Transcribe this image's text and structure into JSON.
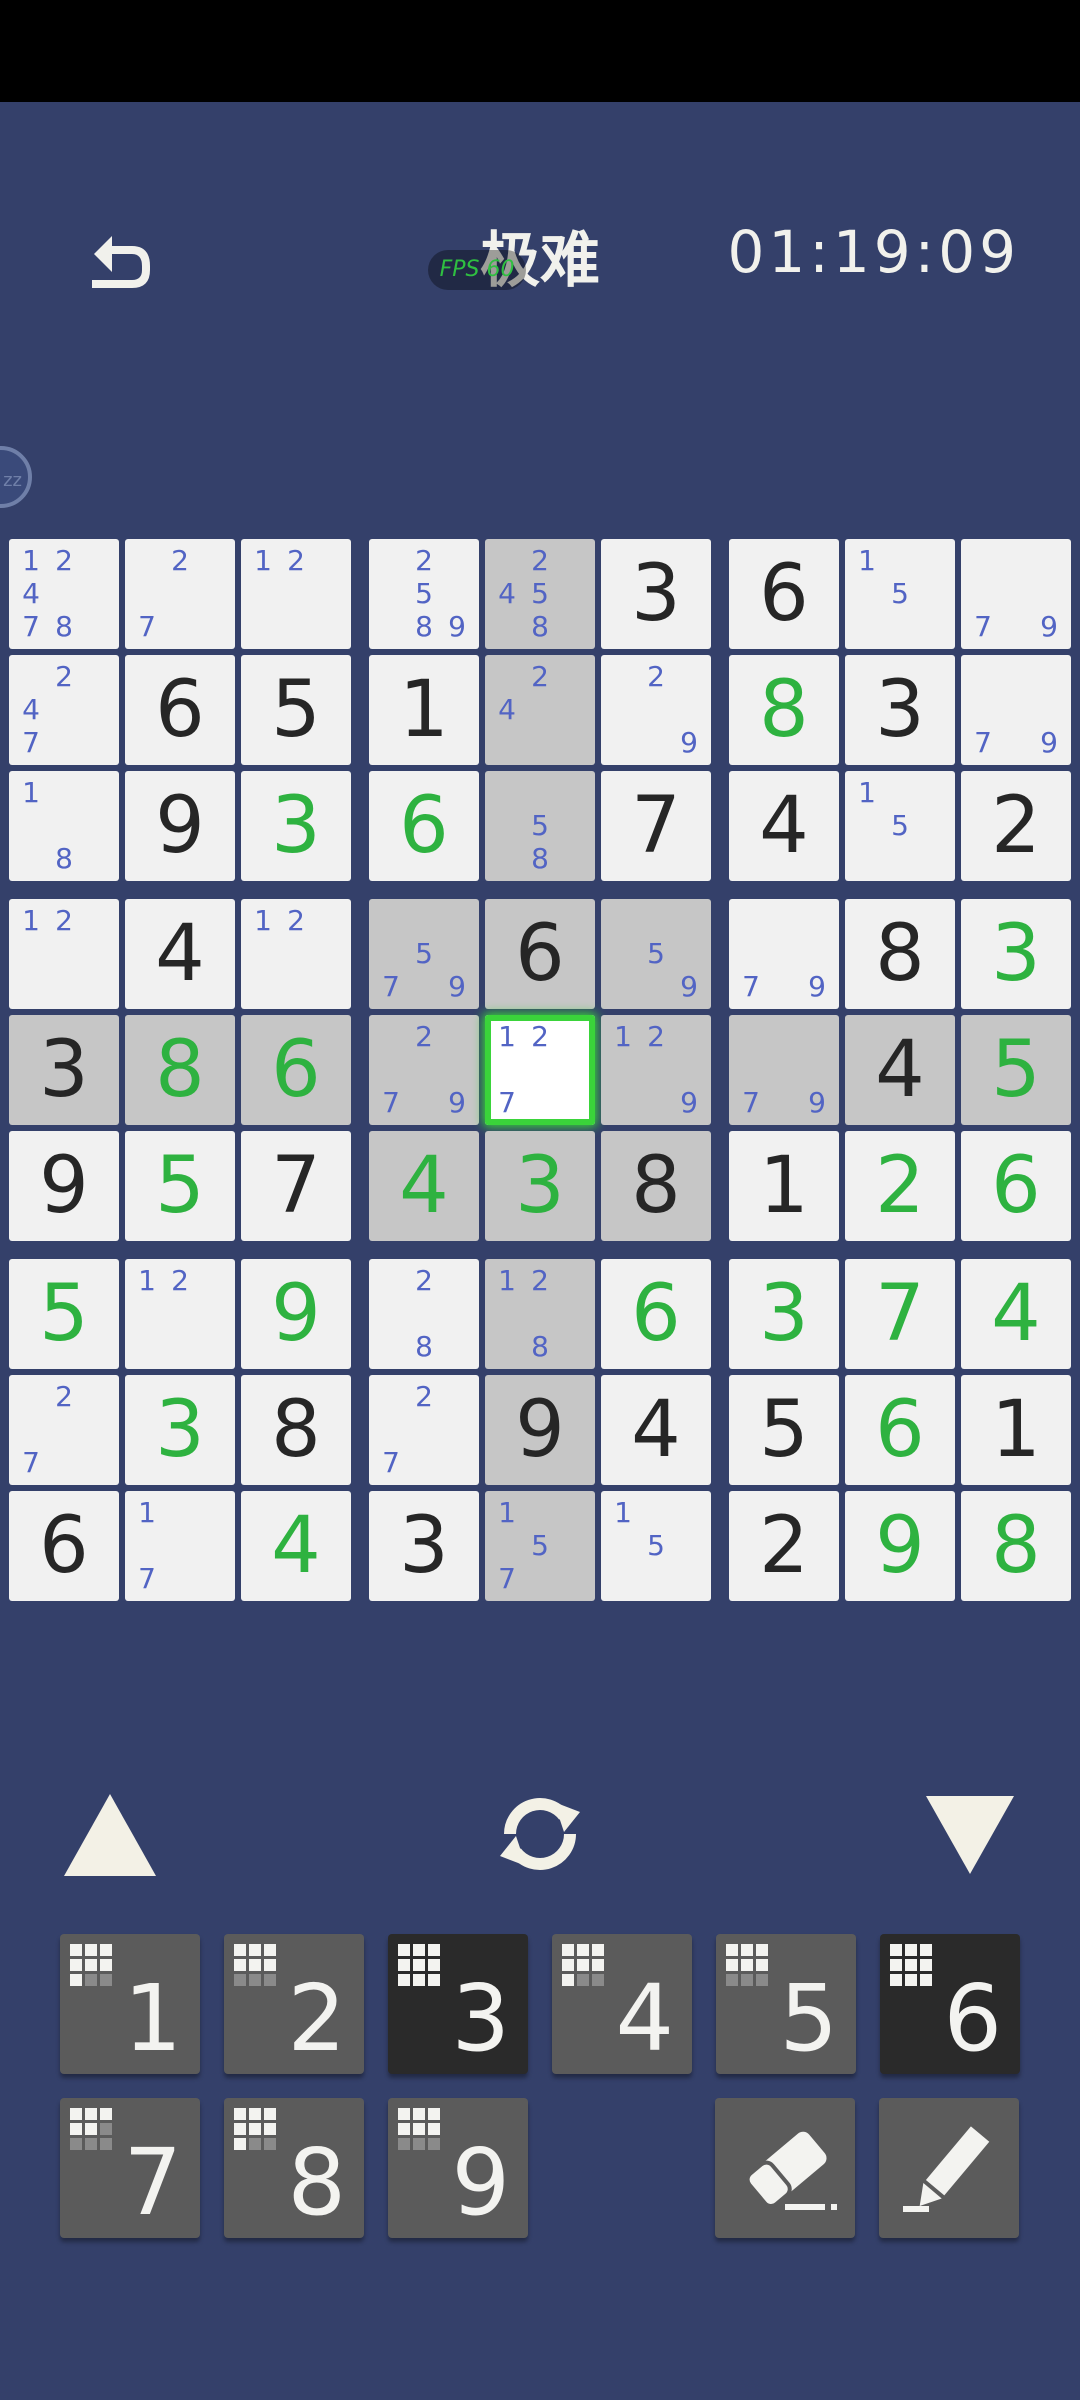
{
  "header": {
    "back_icon": "undo-arrow-icon",
    "difficulty": "极难",
    "fps_badge": "FPS 60",
    "timer": "01:19:09"
  },
  "colors": {
    "background": "#34406a",
    "cell": "#f1f1f1",
    "highlight": "#c6c6c6",
    "given": "#262626",
    "user_entry": "#2eb240",
    "notes": "#5264c4",
    "selected_glow": "#3ad43a"
  },
  "board": {
    "selected": [
      4,
      4
    ],
    "highlighted": [
      [
        0,
        4
      ],
      [
        1,
        4
      ],
      [
        2,
        4
      ],
      [
        3,
        3
      ],
      [
        3,
        4
      ],
      [
        3,
        5
      ],
      [
        4,
        0
      ],
      [
        4,
        1
      ],
      [
        4,
        2
      ],
      [
        4,
        3
      ],
      [
        4,
        5
      ],
      [
        4,
        6
      ],
      [
        4,
        7
      ],
      [
        4,
        8
      ],
      [
        5,
        3
      ],
      [
        5,
        4
      ],
      [
        5,
        5
      ],
      [
        6,
        4
      ],
      [
        7,
        4
      ],
      [
        8,
        4
      ]
    ],
    "rows": [
      [
        {
          "n": [
            1,
            2,
            4,
            7,
            8
          ]
        },
        {
          "n": [
            2,
            7
          ]
        },
        {
          "n": [
            1,
            2
          ]
        },
        {
          "n": [
            2,
            5,
            8,
            9
          ]
        },
        {
          "n": [
            2,
            4,
            5,
            8
          ]
        },
        {
          "v": 3
        },
        {
          "v": 6
        },
        {
          "n": [
            1,
            5
          ]
        },
        {
          "n": [
            7,
            9
          ]
        }
      ],
      [
        {
          "n": [
            2,
            4,
            7
          ]
        },
        {
          "v": 6
        },
        {
          "v": 5
        },
        {
          "v": 1
        },
        {
          "n": [
            2,
            4
          ]
        },
        {
          "n": [
            2,
            9
          ]
        },
        {
          "v": 8,
          "u": true
        },
        {
          "v": 3
        },
        {
          "n": [
            7,
            9
          ]
        }
      ],
      [
        {
          "n": [
            1,
            8
          ]
        },
        {
          "v": 9
        },
        {
          "v": 3,
          "u": true
        },
        {
          "v": 6,
          "u": true
        },
        {
          "n": [
            5,
            8
          ]
        },
        {
          "v": 7
        },
        {
          "v": 4
        },
        {
          "n": [
            1,
            5
          ]
        },
        {
          "v": 2
        }
      ],
      [
        {
          "n": [
            1,
            2
          ]
        },
        {
          "v": 4
        },
        {
          "n": [
            1,
            2
          ]
        },
        {
          "n": [
            5,
            7,
            9
          ]
        },
        {
          "v": 6
        },
        {
          "n": [
            5,
            9
          ]
        },
        {
          "n": [
            7,
            9
          ]
        },
        {
          "v": 8
        },
        {
          "v": 3,
          "u": true
        }
      ],
      [
        {
          "v": 3
        },
        {
          "v": 8,
          "u": true
        },
        {
          "v": 6,
          "u": true
        },
        {
          "n": [
            2,
            7,
            9
          ]
        },
        {
          "n": [
            1,
            2,
            7
          ]
        },
        {
          "n": [
            1,
            2,
            9
          ]
        },
        {
          "n": [
            7,
            9
          ]
        },
        {
          "v": 4
        },
        {
          "v": 5,
          "u": true
        }
      ],
      [
        {
          "v": 9
        },
        {
          "v": 5,
          "u": true
        },
        {
          "v": 7
        },
        {
          "v": 4,
          "u": true
        },
        {
          "v": 3,
          "u": true
        },
        {
          "v": 8
        },
        {
          "v": 1
        },
        {
          "v": 2,
          "u": true
        },
        {
          "v": 6,
          "u": true
        }
      ],
      [
        {
          "v": 5,
          "u": true
        },
        {
          "n": [
            1,
            2
          ]
        },
        {
          "v": 9,
          "u": true
        },
        {
          "n": [
            2,
            8
          ]
        },
        {
          "n": [
            1,
            2,
            8
          ]
        },
        {
          "v": 6,
          "u": true
        },
        {
          "v": 3,
          "u": true
        },
        {
          "v": 7,
          "u": true
        },
        {
          "v": 4,
          "u": true
        }
      ],
      [
        {
          "n": [
            2,
            7
          ]
        },
        {
          "v": 3,
          "u": true
        },
        {
          "v": 8
        },
        {
          "n": [
            2,
            7
          ]
        },
        {
          "v": 9
        },
        {
          "v": 4
        },
        {
          "v": 5
        },
        {
          "v": 6,
          "u": true
        },
        {
          "v": 1
        }
      ],
      [
        {
          "v": 6
        },
        {
          "n": [
            1,
            7
          ]
        },
        {
          "v": 4,
          "u": true
        },
        {
          "v": 3
        },
        {
          "n": [
            1,
            5,
            7
          ]
        },
        {
          "n": [
            1,
            5
          ]
        },
        {
          "v": 2
        },
        {
          "v": 9,
          "u": true
        },
        {
          "v": 8,
          "u": true
        }
      ]
    ]
  },
  "controls": {
    "up_icon": "triangle-up-icon",
    "refresh_icon": "refresh-icon",
    "down_icon": "triangle-down-icon"
  },
  "keypad": [
    {
      "label": "1",
      "remaining": 7,
      "done": false
    },
    {
      "label": "2",
      "remaining": 6,
      "done": false
    },
    {
      "label": "3",
      "remaining": 9,
      "done": true
    },
    {
      "label": "4",
      "remaining": 7,
      "done": false
    },
    {
      "label": "5",
      "remaining": 6,
      "done": false
    },
    {
      "label": "6",
      "remaining": 9,
      "done": true
    },
    {
      "label": "7",
      "remaining": 5,
      "done": false
    },
    {
      "label": "8",
      "remaining": 7,
      "done": false
    },
    {
      "label": "9",
      "remaining": 6,
      "done": false
    }
  ],
  "tools": {
    "eraser_icon": "eraser-icon",
    "pencil_icon": "pencil-icon"
  }
}
